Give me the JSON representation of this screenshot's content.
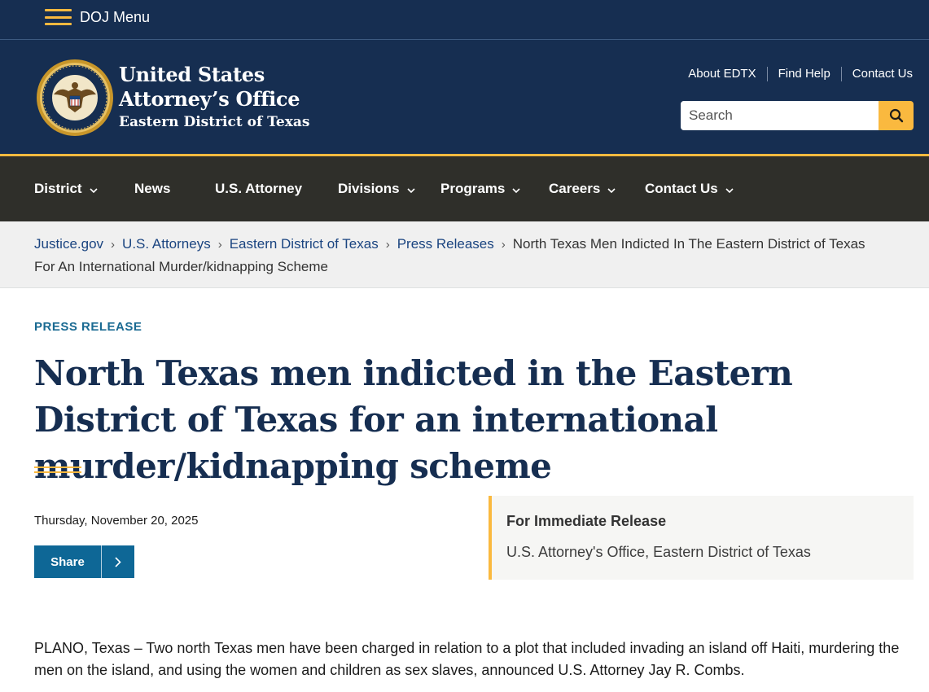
{
  "topbar": {
    "menu_label": "DOJ Menu"
  },
  "header": {
    "office_line1": "United States",
    "office_line2": "Attorney’s Office",
    "office_line3": "Eastern District of Texas",
    "utility_links": [
      "About EDTX",
      "Find Help",
      "Contact Us"
    ],
    "search_placeholder": "Search"
  },
  "nav": {
    "items": [
      {
        "label": "District",
        "dropdown": true
      },
      {
        "label": "News",
        "dropdown": false
      },
      {
        "label": "U.S. Attorney",
        "dropdown": false
      },
      {
        "label": "Divisions",
        "dropdown": true
      },
      {
        "label": "Programs",
        "dropdown": true
      },
      {
        "label": "Careers",
        "dropdown": true
      },
      {
        "label": "Contact Us",
        "dropdown": true
      }
    ]
  },
  "breadcrumb": {
    "links": [
      "Justice.gov",
      "U.S. Attorneys",
      "Eastern District of Texas",
      "Press Releases"
    ],
    "current": "North Texas Men Indicted In The Eastern District of Texas For An International Murder/kidnapping Scheme"
  },
  "article": {
    "eyebrow": "PRESS RELEASE",
    "title": "North Texas men indicted in the Eastern District of Texas for an international murder/kidnapping scheme",
    "date": "Thursday, November 20, 2025",
    "share_label": "Share",
    "release_title": "For Immediate Release",
    "release_office": "U.S. Attorney's Office, Eastern District of Texas",
    "lead": "PLANO, Texas – Two north Texas men have been charged in relation to a plot that included invading an island off Haiti, murdering the men on the island, and using the women and children as sex slaves, announced U.S. Attorney Jay R. Combs."
  },
  "colors": {
    "navy": "#162e51",
    "gold": "#fab93f",
    "nav_bg": "#2f2f2a",
    "link_blue": "#1a4480",
    "share_blue": "#0e6796"
  },
  "icons": [
    "hamburger-icon",
    "doj-seal-logo",
    "search-icon",
    "chevron-down-icon",
    "breadcrumb-chevron-icon",
    "chevron-right-icon"
  ]
}
